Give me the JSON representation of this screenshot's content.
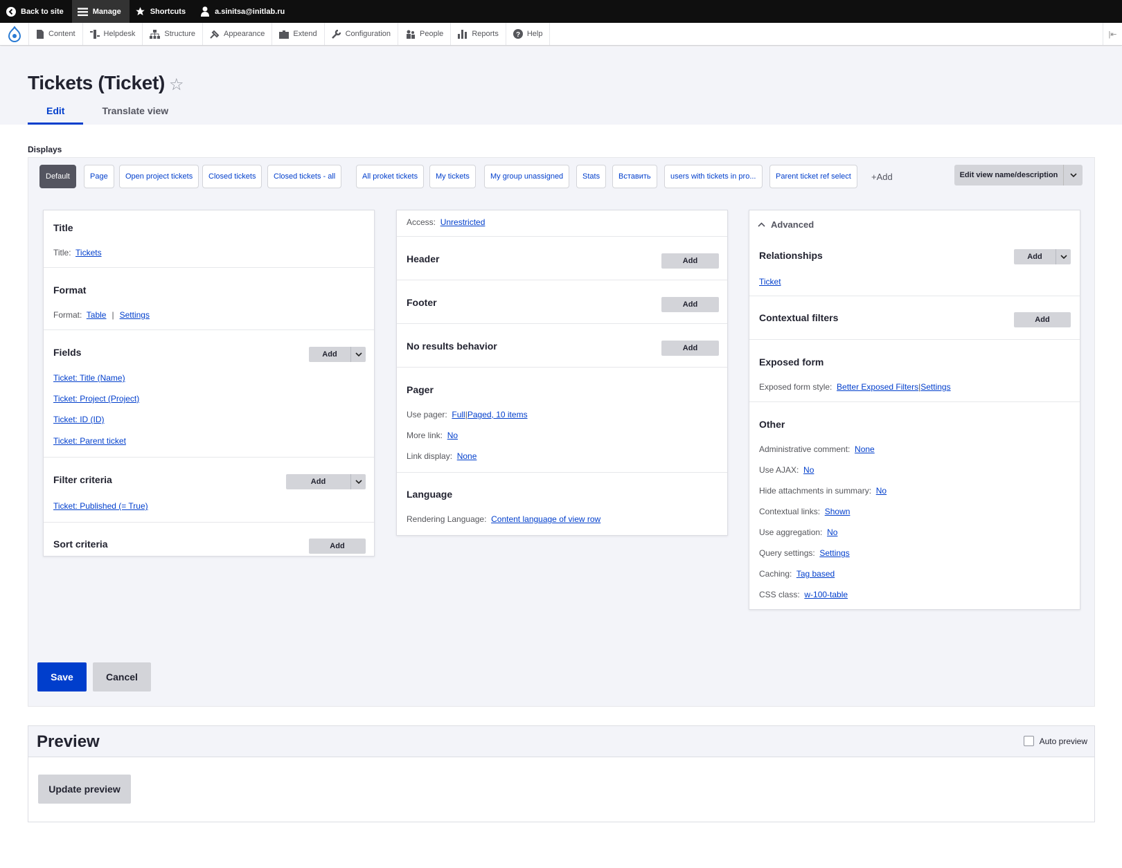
{
  "toolbar": {
    "back": "Back to site",
    "manage": "Manage",
    "shortcuts": "Shortcuts",
    "user": "a.sinitsa@initlab.ru"
  },
  "tray": {
    "items": [
      "Content",
      "Helpdesk",
      "Structure",
      "Appearance",
      "Extend",
      "Configuration",
      "People",
      "Reports",
      "Help"
    ]
  },
  "page": {
    "title": "Tickets (Ticket)",
    "tabs": [
      "Edit",
      "Translate view"
    ]
  },
  "displays": {
    "label": "Displays",
    "tabs": [
      "Default",
      "Page",
      "Open project tickets",
      "Closed tickets",
      "Closed tickets - all",
      "All proket tickets",
      "My tickets",
      "My group unassigned",
      "Stats",
      "Вставить",
      "users with tickets in pro...",
      "Parent ticket ref select"
    ],
    "add": "+Add",
    "edit_menu": "Edit view name/description"
  },
  "col1": {
    "title": {
      "heading": "Title",
      "label": "Title:",
      "value": "Tickets"
    },
    "format": {
      "heading": "Format",
      "label": "Format:",
      "value": "Table",
      "settings": "Settings"
    },
    "fields": {
      "heading": "Fields",
      "add": "Add",
      "items": [
        "Ticket: Title (Name)",
        "Ticket: Project (Project)",
        "Ticket: ID (ID)",
        "Ticket: Parent ticket"
      ]
    },
    "filter": {
      "heading": "Filter criteria",
      "add": "Add",
      "items": [
        "Ticket: Published (= True)"
      ]
    },
    "sort": {
      "heading": "Sort criteria",
      "add": "Add"
    }
  },
  "col2": {
    "access": {
      "label": "Access:",
      "value": "Unrestricted"
    },
    "header": {
      "heading": "Header",
      "add": "Add"
    },
    "footer": {
      "heading": "Footer",
      "add": "Add"
    },
    "no_results": {
      "heading": "No results behavior",
      "add": "Add"
    },
    "pager": {
      "heading": "Pager",
      "use_label": "Use pager:",
      "use_full": "Full",
      "use_paged": "Paged, 10 items",
      "more_label": "More link:",
      "more_value": "No",
      "link_label": "Link display:",
      "link_value": "None"
    },
    "language": {
      "heading": "Language",
      "label": "Rendering Language:",
      "value": "Content language of view row"
    }
  },
  "col3": {
    "advanced": "Advanced",
    "relationships": {
      "heading": "Relationships",
      "add": "Add",
      "items": [
        "Ticket"
      ]
    },
    "contextual": {
      "heading": "Contextual filters",
      "add": "Add"
    },
    "exposed": {
      "heading": "Exposed form",
      "label": "Exposed form style:",
      "value": "Better Exposed Filters",
      "settings": "Settings"
    },
    "other": {
      "heading": "Other",
      "rows": [
        {
          "label": "Administrative comment:",
          "value": "None"
        },
        {
          "label": "Use AJAX:",
          "value": "No"
        },
        {
          "label": "Hide attachments in summary:",
          "value": "No"
        },
        {
          "label": "Contextual links:",
          "value": "Shown"
        },
        {
          "label": "Use aggregation:",
          "value": "No"
        },
        {
          "label": "Query settings:",
          "value": "Settings"
        },
        {
          "label": "Caching:",
          "value": "Tag based"
        },
        {
          "label": "CSS class:",
          "value": "w-100-table"
        }
      ]
    }
  },
  "actions": {
    "save": "Save",
    "cancel": "Cancel"
  },
  "preview": {
    "title": "Preview",
    "auto": "Auto preview",
    "update": "Update preview"
  }
}
